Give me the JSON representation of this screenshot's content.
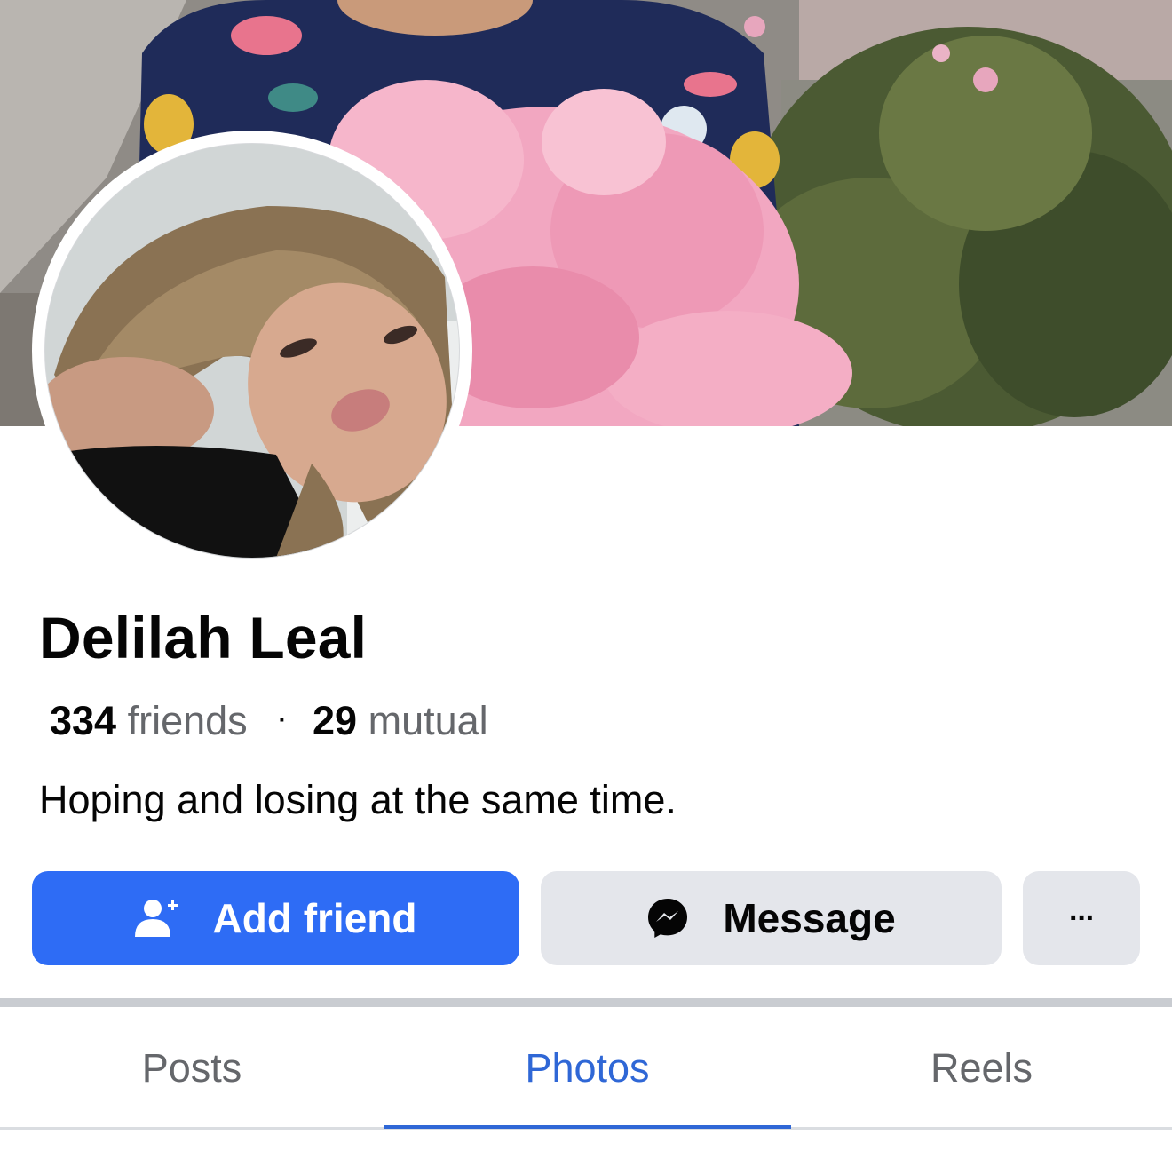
{
  "profile": {
    "name": "Delilah Leal",
    "friends_count": "334",
    "friends_label": "friends",
    "separator": "·",
    "mutual_count": "29",
    "mutual_label": "mutual",
    "bio": "Hoping and losing at the same time."
  },
  "actions": {
    "add_friend": "Add friend",
    "message": "Message",
    "more": "···"
  },
  "tabs": [
    {
      "label": "Posts",
      "active": false
    },
    {
      "label": "Photos",
      "active": true
    },
    {
      "label": "Reels",
      "active": false
    }
  ],
  "icons": {
    "add_friend": "person-plus-icon",
    "message": "messenger-icon",
    "more": "ellipsis-icon"
  },
  "colors": {
    "primary_button": "#2e6cf5",
    "secondary_button": "#e4e6eb",
    "active_tab": "#2f67d6",
    "muted_text": "#65676b"
  }
}
